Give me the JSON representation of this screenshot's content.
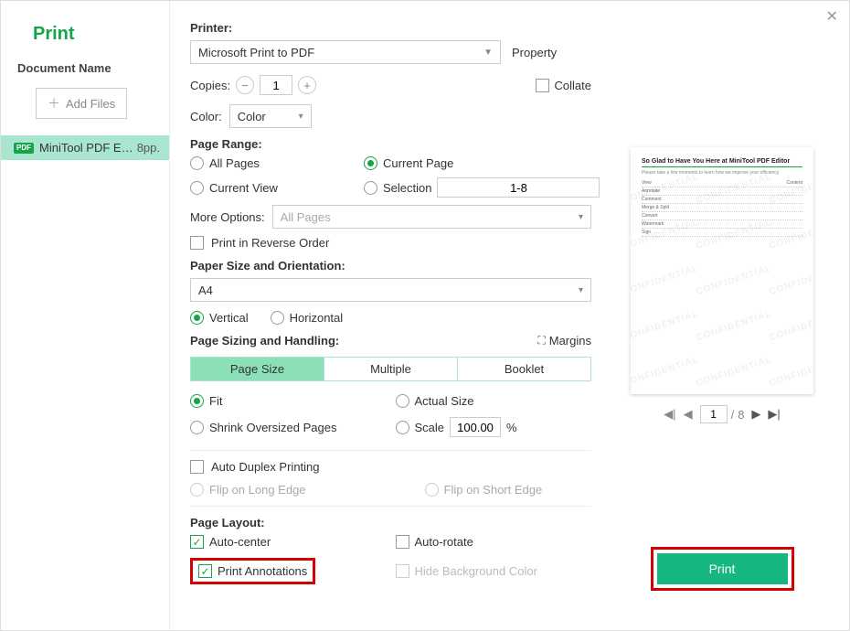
{
  "title": "Print",
  "doc_heading": "Document Name",
  "add_files_label": "Add Files",
  "file": {
    "name": "MiniTool PDF E…",
    "pp": "8pp."
  },
  "printer": {
    "label": "Printer:",
    "selected": "Microsoft Print to PDF",
    "property": "Property"
  },
  "copies": {
    "label": "Copies:",
    "value": "1"
  },
  "collate_label": "Collate",
  "color": {
    "label": "Color:",
    "selected": "Color"
  },
  "page_range": {
    "label": "Page Range:",
    "all": "All Pages",
    "current_page": "Current Page",
    "current_view": "Current View",
    "selection": "Selection",
    "range_value": "1-8"
  },
  "more_options": {
    "label": "More Options:",
    "value": "All Pages"
  },
  "reverse_label": "Print in Reverse Order",
  "paper": {
    "label": "Paper Size and Orientation:",
    "size": "A4",
    "vertical": "Vertical",
    "horizontal": "Horizontal"
  },
  "sizing": {
    "label": "Page Sizing and Handling:",
    "margins": "Margins",
    "segments": {
      "page_size": "Page Size",
      "multiple": "Multiple",
      "booklet": "Booklet"
    },
    "fit": "Fit",
    "actual": "Actual Size",
    "shrink": "Shrink Oversized Pages",
    "scale": "Scale",
    "scale_value": "100.00",
    "percent": "%"
  },
  "duplex": {
    "auto": "Auto Duplex Printing",
    "long": "Flip on Long Edge",
    "short": "Flip on Short Edge"
  },
  "layout": {
    "label": "Page Layout:",
    "auto_center": "Auto-center",
    "auto_rotate": "Auto-rotate",
    "print_annotations": "Print Annotations",
    "hide_bg": "Hide Background Color"
  },
  "preview": {
    "page_title": "So Glad to Have You Here at MiniTool PDF Editor",
    "watermark": "CONFIDENTIAL",
    "nav": {
      "current": "1",
      "total": "8"
    }
  },
  "print_button": "Print"
}
